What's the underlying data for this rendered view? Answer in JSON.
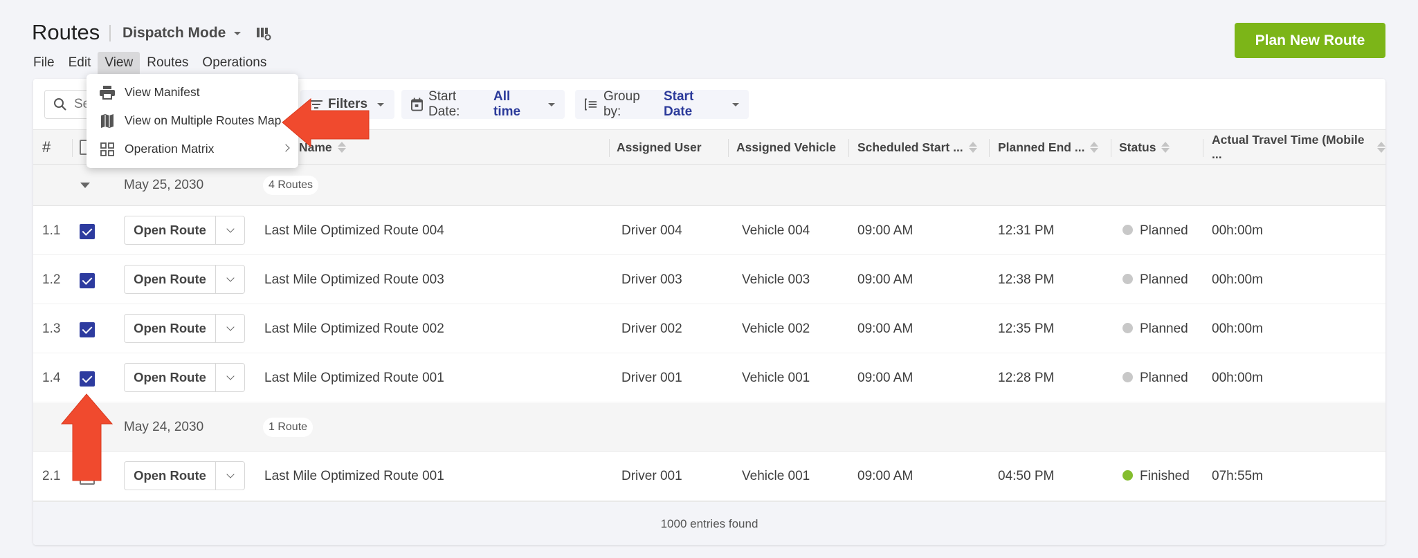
{
  "header": {
    "title": "Routes",
    "mode_label": "Dispatch Mode",
    "plan_button": "Plan New Route"
  },
  "menubar": {
    "items": [
      "File",
      "Edit",
      "View",
      "Routes",
      "Operations"
    ],
    "active": "View"
  },
  "view_menu": {
    "items": [
      {
        "label": "View Manifest",
        "icon": "printer-icon"
      },
      {
        "label": "View on Multiple Routes Map",
        "icon": "map-icon"
      },
      {
        "label": "Operation Matrix",
        "icon": "grid-icon",
        "submenu": true
      }
    ]
  },
  "toolbar": {
    "search_placeholder": "Search",
    "filters_label": "Filters",
    "start_date_label": "Start Date:",
    "start_date_value": "All time",
    "group_by_label": "Group by:",
    "group_by_value": "Start Date"
  },
  "table": {
    "columns": {
      "num": "#",
      "name": "Name",
      "assigned_user": "Assigned User",
      "assigned_vehicle": "Assigned Vehicle",
      "scheduled_start": "Scheduled Start ...",
      "planned_end": "Planned End ...",
      "status": "Status",
      "actual_travel": "Actual Travel Time (Mobile ..."
    },
    "open_route_label": "Open Route",
    "groups": [
      {
        "date": "May 25, 2030",
        "count_label": "4 Routes",
        "rows": [
          {
            "num": "1.1",
            "checked": true,
            "name": "Last Mile Optimized Route 004",
            "user": "Driver 004",
            "vehicle": "Vehicle 004",
            "start": "09:00 AM",
            "end": "12:31 PM",
            "status": "Planned",
            "travel": "00h:00m"
          },
          {
            "num": "1.2",
            "checked": true,
            "name": "Last Mile Optimized Route 003",
            "user": "Driver 003",
            "vehicle": "Vehicle 003",
            "start": "09:00 AM",
            "end": "12:38 PM",
            "status": "Planned",
            "travel": "00h:00m"
          },
          {
            "num": "1.3",
            "checked": true,
            "name": "Last Mile Optimized Route 002",
            "user": "Driver 002",
            "vehicle": "Vehicle 002",
            "start": "09:00 AM",
            "end": "12:35 PM",
            "status": "Planned",
            "travel": "00h:00m"
          },
          {
            "num": "1.4",
            "checked": true,
            "name": "Last Mile Optimized Route 001",
            "user": "Driver 001",
            "vehicle": "Vehicle 001",
            "start": "09:00 AM",
            "end": "12:28 PM",
            "status": "Planned",
            "travel": "00h:00m"
          }
        ]
      },
      {
        "date": "May 24, 2030",
        "count_label": "1 Route",
        "rows": [
          {
            "num": "2.1",
            "checked": false,
            "name": "Last Mile Optimized Route 001",
            "user": "Driver 001",
            "vehicle": "Vehicle 001",
            "start": "09:00 AM",
            "end": "04:50 PM",
            "status": "Finished",
            "travel": "07h:55m"
          }
        ]
      }
    ],
    "footer": "1000 entries found"
  },
  "colors": {
    "accent_green": "#7cb518",
    "link_blue": "#2b3a9a",
    "checkbox": "#2d3b9f",
    "status_planned": "#c8c8c8",
    "status_finished": "#84bd2e",
    "annotation_arrow": "#f04a2e"
  }
}
